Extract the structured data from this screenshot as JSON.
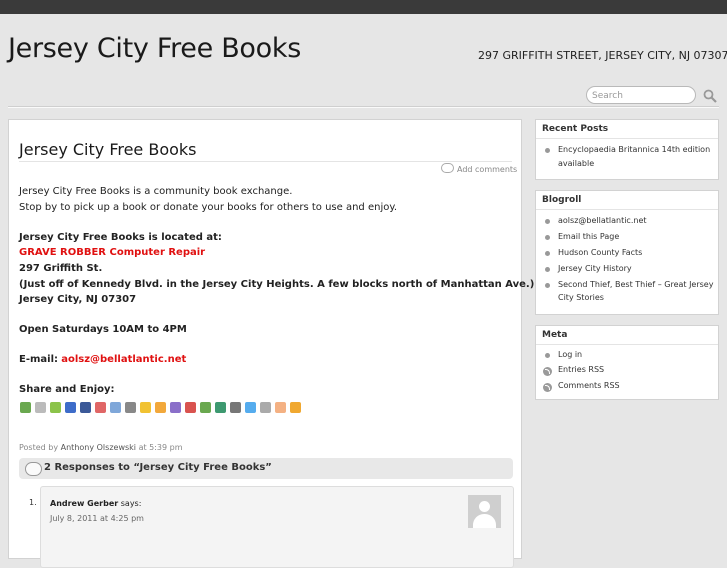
{
  "site": {
    "title": "Jersey City Free Books",
    "address": "297 GRIFFITH STREET, JERSEY CITY, NJ 07307"
  },
  "search": {
    "placeholder": "Search"
  },
  "post": {
    "title": "Jersey City Free Books",
    "add_comments": "Add comments",
    "intro1": "Jersey City Free Books is a community book exchange.",
    "intro2": "Stop by to pick up a book or donate your books for others to use and enjoy.",
    "located_at": "Jersey City Free Books is located at:",
    "store_name": "GRAVE ROBBER Computer Repair",
    "street": "297 Griffith St.",
    "directions": "(Just off of Kennedy Blvd. in the Jersey City Heights. A few blocks north of Manhattan Ave.)",
    "city": "Jersey City, NJ 07307",
    "hours": "Open Saturdays 10AM to 4PM",
    "email_label": "E-mail:",
    "email": "aolsz@bellatlantic.net",
    "share_label": "Share and Enjoy:",
    "share_icon_colors": [
      "#6aa84f",
      "#bbbbbb",
      "#8bc34a",
      "#3d6cc9",
      "#3b5998",
      "#e06666",
      "#7fa7d9",
      "#888888",
      "#f1c232",
      "#f2a83b",
      "#8a6fc9",
      "#d9534f",
      "#6aa84f",
      "#3d9970",
      "#777777",
      "#55acee",
      "#aaaaaa",
      "#f4b183",
      "#f0a830"
    ],
    "posted_prefix": "Posted by",
    "posted_author": "Anthony Olszewski",
    "posted_suffix": "at 5:39 pm"
  },
  "responses": {
    "heading": "2 Responses to “Jersey City Free Books”",
    "comments": [
      {
        "number": "1.",
        "author": "Andrew Gerber",
        "says": "says:",
        "date": "July 8, 2011 at 4:25 pm"
      }
    ]
  },
  "sidebar": {
    "recent_posts": {
      "title": "Recent Posts",
      "items": [
        "Encyclopaedia Britannica 14th edition",
        "available"
      ]
    },
    "blogroll": {
      "title": "Blogroll",
      "items": [
        "aolsz@bellatlantic.net",
        "Email this Page",
        "Hudson County Facts",
        "Jersey City History",
        "Second Thief, Best Thief – Great Jersey",
        "City Stories"
      ]
    },
    "meta": {
      "title": "Meta",
      "items": [
        "Log in",
        "Entries RSS",
        "Comments RSS"
      ]
    }
  }
}
